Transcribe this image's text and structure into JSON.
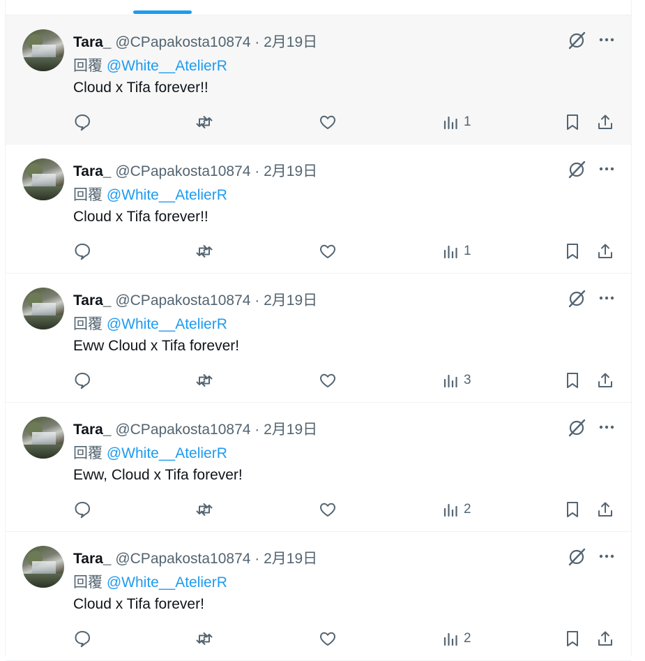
{
  "tweets": [
    {
      "name": "Tara_",
      "handle": "@CPapakosta10874",
      "dot": " · ",
      "date": "2月19日",
      "reply_prefix": "回覆 ",
      "reply_to": "@White__AtelierR",
      "text": "Cloud x Tifa forever!!",
      "views": "1",
      "highlighted": true
    },
    {
      "name": "Tara_",
      "handle": "@CPapakosta10874",
      "dot": " · ",
      "date": "2月19日",
      "reply_prefix": "回覆 ",
      "reply_to": "@White__AtelierR",
      "text": "Cloud x Tifa forever!!",
      "views": "1",
      "highlighted": false
    },
    {
      "name": "Tara_",
      "handle": "@CPapakosta10874",
      "dot": " · ",
      "date": "2月19日",
      "reply_prefix": "回覆 ",
      "reply_to": "@White__AtelierR",
      "text": "Eww Cloud x Tifa forever!",
      "views": "3",
      "highlighted": false
    },
    {
      "name": "Tara_",
      "handle": "@CPapakosta10874",
      "dot": " · ",
      "date": "2月19日",
      "reply_prefix": "回覆 ",
      "reply_to": "@White__AtelierR",
      "text": "Eww, Cloud x Tifa forever!",
      "views": "2",
      "highlighted": false
    },
    {
      "name": "Tara_",
      "handle": "@CPapakosta10874",
      "dot": " · ",
      "date": "2月19日",
      "reply_prefix": "回覆 ",
      "reply_to": "@White__AtelierR",
      "text": "Cloud x Tifa forever!",
      "views": "2",
      "highlighted": false
    }
  ],
  "icons": {
    "grok": "grok-icon",
    "more": "more-icon",
    "reply": "reply-icon",
    "retweet": "retweet-icon",
    "like": "like-icon",
    "views": "views-icon",
    "bookmark": "bookmark-icon",
    "share": "share-icon"
  },
  "colors": {
    "accent": "#1d9bf0",
    "muted": "#536471",
    "text": "#0f1419",
    "hover_bg": "#f7f7f7"
  }
}
